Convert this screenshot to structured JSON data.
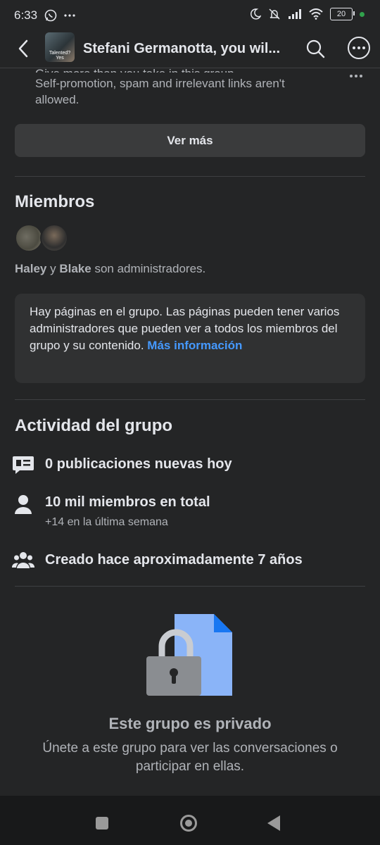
{
  "status_bar": {
    "time": "6:33",
    "battery": "20",
    "icons": [
      "whatsapp-icon",
      "more-notifications-icon",
      "moon-icon",
      "mute-icon",
      "signal-icon",
      "wifi-icon",
      "battery-icon"
    ]
  },
  "header": {
    "title": "Stefani Germanotta, you wil...",
    "avatar_caption": "Talented? Yes",
    "icons": [
      "back-icon",
      "search-icon",
      "more-icon"
    ]
  },
  "about": {
    "rule_lines": [
      "Give more than you take in this group.",
      "Self-promotion, spam and irrelevant links aren't",
      "allowed."
    ],
    "see_more_label": "Ver más"
  },
  "members": {
    "title": "Miembros",
    "admin_1": "Haley",
    "connector": "y",
    "admin_2": "Blake",
    "admins_suffix": "son administradores.",
    "info_text": "Hay páginas en el grupo. Las páginas pueden tener varios administradores que pueden ver a todos los miembros del grupo y su contenido.",
    "info_link": "Más información"
  },
  "activity": {
    "title": "Actividad del grupo",
    "posts_today": "0 publicaciones nuevas hoy",
    "members_total": "10 mil miembros en total",
    "members_week": "+14 en la última semana",
    "created": "Creado hace aproximadamente 7 años"
  },
  "private": {
    "title": "Este grupo es privado",
    "description": "Únete a este grupo para ver las conversaciones o participar en ellas."
  },
  "colors": {
    "background": "#242526",
    "card": "#3a3b3c",
    "link": "#4599ff",
    "doc_blue": "#8ab4f8",
    "lock_grey": "#8a8d91"
  }
}
